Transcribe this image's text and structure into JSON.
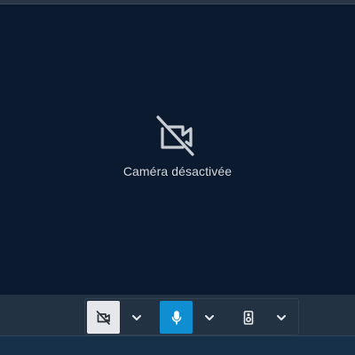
{
  "video": {
    "status_icon": "camera-off-icon",
    "status_text": "Caméra désactivée"
  },
  "toolbar": {
    "camera_button": {
      "icon": "camera-off-icon",
      "state": "off"
    },
    "camera_options": {
      "icon": "chevron-down-icon"
    },
    "mic_button": {
      "icon": "microphone-icon",
      "state": "active"
    },
    "mic_options": {
      "icon": "chevron-down-icon"
    },
    "speaker_button": {
      "icon": "speaker-icon"
    },
    "speaker_options": {
      "icon": "chevron-down-icon"
    }
  },
  "colors": {
    "background": "#0b1a2f",
    "toolbar": "#223242",
    "camera_button_bg": "#e5e7ea",
    "accent": "#0f8fd1",
    "text": "#d3d7dc",
    "bottom_band": "#163049"
  }
}
